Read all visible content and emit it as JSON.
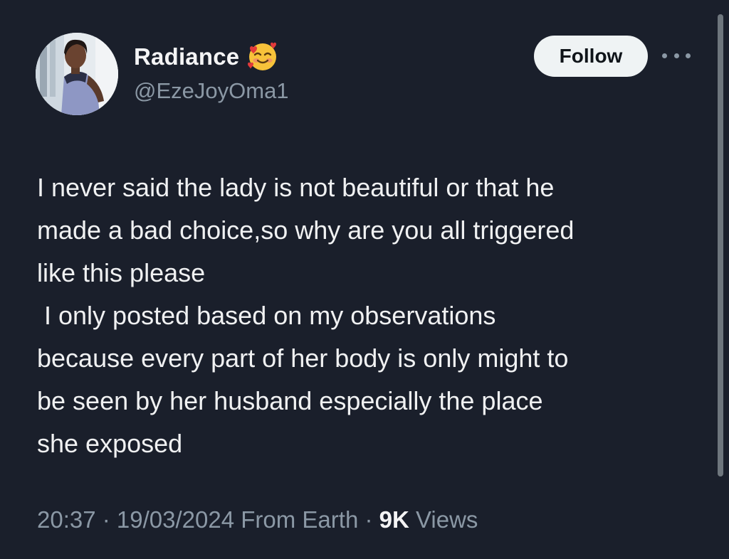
{
  "author": {
    "display_name": "Radiance",
    "name_emoji": "smiling-face-with-hearts",
    "handle": "@EzeJoyOma1",
    "avatar": "profile-photo"
  },
  "actions": {
    "follow_label": "Follow",
    "more_icon": "more-horizontal-icon"
  },
  "tweet": {
    "lines": [
      "I never said the lady is not beautiful or that he",
      "made a bad choice,so why are you all triggered",
      "like this please",
      " I only posted based on my observations",
      "because every part of her body is only might to",
      "be seen by her husband especially the place",
      "she exposed"
    ]
  },
  "meta": {
    "time": "20:37",
    "separator": " · ",
    "date": "19/03/2024",
    "source": "From Earth",
    "views_count": "9K",
    "views_label": "Views"
  },
  "colors": {
    "background": "#1a1f2b",
    "text": "#f0f1f2",
    "secondary": "#8b98a5",
    "follow_bg": "#eff3f4"
  }
}
